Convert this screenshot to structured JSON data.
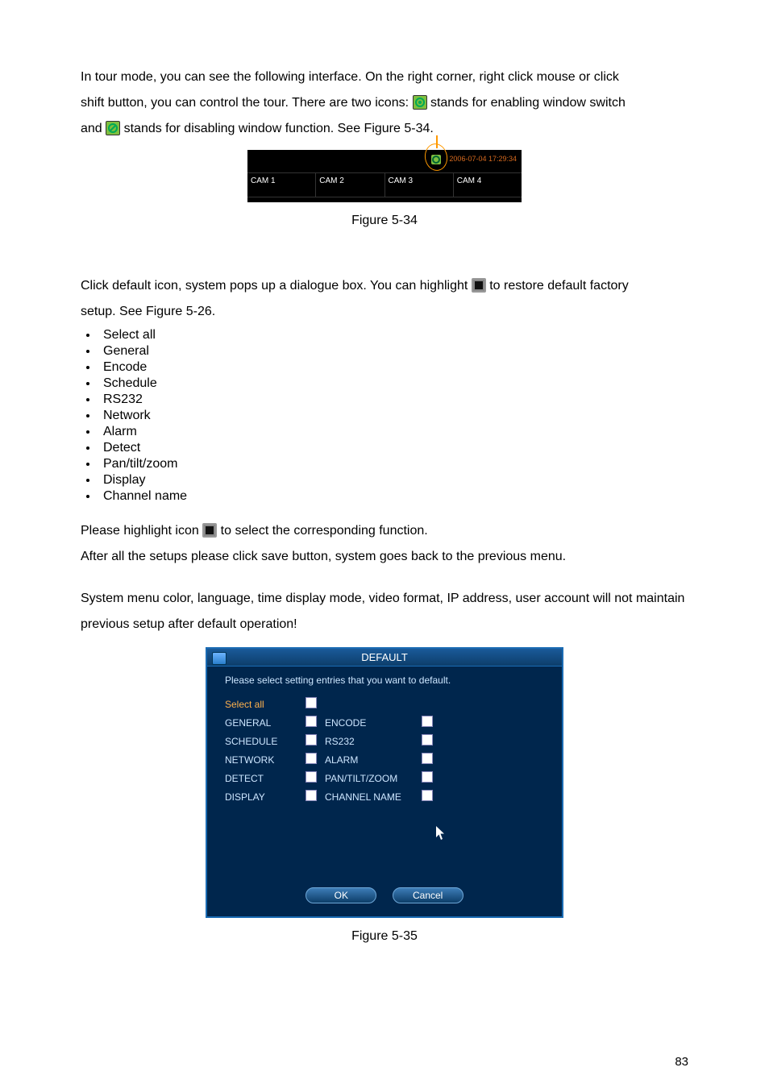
{
  "para1": {
    "t1": "In tour mode, you can see the following interface. On the right corner, right click mouse or click",
    "t2": "shift button, you can control the tour. There are two icons: ",
    "t3": " stands for enabling window switch",
    "t4": "and ",
    "t5": " stands for disabling window function. See Figure 5-34."
  },
  "fig534": {
    "timestamp": "2006-07-04 17:29:34",
    "cams": [
      "CAM 1",
      "CAM 2",
      "CAM 3",
      "CAM 4"
    ],
    "caption": "Figure 5-34"
  },
  "para2": {
    "t1": "Click default icon, system pops up a dialogue box. You can highlight ",
    "t2": " to restore default factory",
    "t3": "setup. See Figure 5-26."
  },
  "bullets": [
    "Select all",
    "General",
    "Encode",
    "Schedule",
    "RS232",
    "Network",
    "Alarm",
    "Detect",
    "Pan/tilt/zoom",
    "Display",
    "Channel name"
  ],
  "para3": {
    "t1": "Please highlight icon ",
    "t2": " to select the corresponding function.",
    "t3": "After all the setups please click save button, system goes back to the previous menu."
  },
  "para4": "System menu color, language, time display mode, video format, IP address, user account will not maintain previous setup after default operation!",
  "fig535": {
    "title": "DEFAULT",
    "instr": "Please select setting entries that you want to default.",
    "left": [
      {
        "label": "Select all",
        "cls": "selectall"
      },
      {
        "label": "GENERAL",
        "cls": "lbl"
      },
      {
        "label": "SCHEDULE",
        "cls": "lbl"
      },
      {
        "label": "NETWORK",
        "cls": "lbl"
      },
      {
        "label": "DETECT",
        "cls": "lbl"
      },
      {
        "label": "DISPLAY",
        "cls": "lbl"
      }
    ],
    "right": [
      "",
      "ENCODE",
      "RS232",
      "ALARM",
      "PAN/TILT/ZOOM",
      "CHANNEL NAME"
    ],
    "ok": "OK",
    "cancel": "Cancel",
    "caption": "Figure 5-35"
  },
  "pageNumber": "83"
}
